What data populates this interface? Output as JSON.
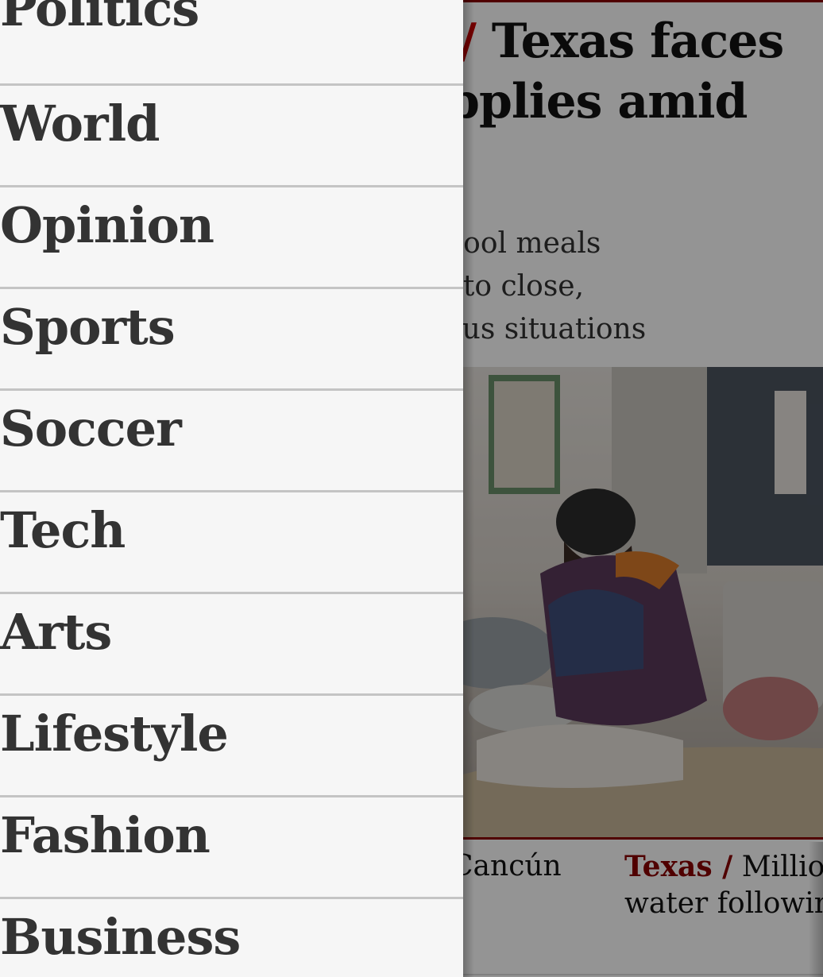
{
  "article": {
    "headline": {
      "line1": "Texas faces",
      "line2": "pplies amid",
      "slash": "/"
    },
    "standfirst": [
      "hool meals",
      ". to close,",
      "ous situations"
    ],
    "photo_alt": "Man sitting on a mat with blankets in a warming shelter",
    "related": [
      {
        "kicker": "",
        "text": "Cancún",
        "line2": ""
      },
      {
        "kicker": "Texas /",
        "text": " Million",
        "line2": "water following"
      }
    ]
  },
  "nav": {
    "items": [
      {
        "label": "Politics"
      },
      {
        "label": "World"
      },
      {
        "label": "Opinion"
      },
      {
        "label": "Sports"
      },
      {
        "label": "Soccer"
      },
      {
        "label": "Tech"
      },
      {
        "label": "Arts"
      },
      {
        "label": "Lifestyle"
      },
      {
        "label": "Fashion"
      },
      {
        "label": "Business"
      }
    ]
  },
  "colors": {
    "brand_red": "#8b0000",
    "headline_slash": "#c70000",
    "drawer_bg": "#f6f6f6",
    "nav_text": "#333333",
    "divider": "#c4c4c4"
  }
}
